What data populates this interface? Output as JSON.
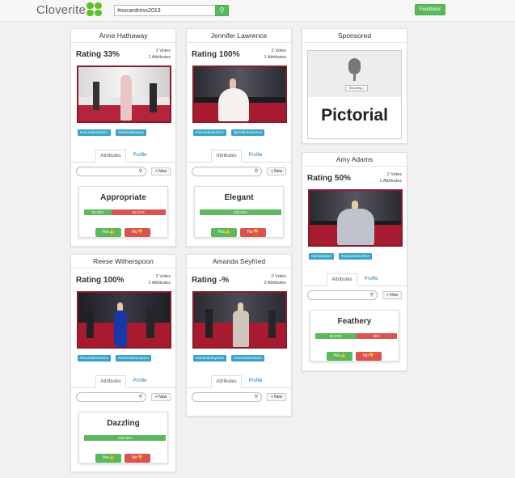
{
  "header": {
    "logo_text": "Cloverite",
    "search_value": "#oscardress2013",
    "search_icon": "search-icon",
    "feedback_label": "Feedback"
  },
  "colors": {
    "accent_green": "#5cb85c",
    "accent_red": "#d9534f",
    "tag_blue": "#3aa3c9",
    "link_blue": "#2a7ab8",
    "photo_border": "#8a1b2e"
  },
  "tab_labels": {
    "attributes": "Attributes",
    "profile": "Profile"
  },
  "new_label": "+ New",
  "yes_label": "Yes👍",
  "no_label": "No👎",
  "cards": [
    {
      "name": "Anne Hathaway",
      "rating": "Rating 33%",
      "votes": "3 Votes",
      "attributes": "1 Attributes",
      "tags": [
        "#oscardress2013",
        "#annehathaway"
      ],
      "attribute": {
        "name": "Appropriate",
        "yes_pct": "33.33%",
        "no_pct": "66.67%",
        "yes_fraction": 0.3333
      }
    },
    {
      "name": "Jennifer Lawrence",
      "rating": "Rating 100%",
      "votes": "2 Votes",
      "attributes": "1 Attributes",
      "tags": [
        "#oscardress2013",
        "#jenniferlawrence"
      ],
      "attribute": {
        "name": "Elegant",
        "yes_pct": "100.00%",
        "no_pct": "",
        "yes_fraction": 1.0
      }
    },
    {
      "name": "Reese Witherspoon",
      "rating": "Rating 100%",
      "votes": "2 Votes",
      "attributes": "1 Attributes",
      "tags": [
        "#oscardress2013",
        "#reesewitherspoon"
      ],
      "attribute": {
        "name": "Dazzling",
        "yes_pct": "100.00%",
        "no_pct": "",
        "yes_fraction": 1.0
      }
    },
    {
      "name": "Amanda Seyfried",
      "rating": "Rating -%",
      "votes": "0 Votes",
      "attributes": "0 Attributes",
      "tags": [
        "#amandaseyfried",
        "#oscardress2013"
      ]
    },
    {
      "name": "Amy Adams",
      "rating": "Rating 50%",
      "votes": "2 Votes",
      "attributes": "1 Attributes",
      "tags": [
        "#amyadams",
        "#oscardress2013"
      ],
      "attribute": {
        "name": "Feathery",
        "yes_pct": "50.00%",
        "no_pct": "50%",
        "yes_fraction": 0.5
      }
    }
  ],
  "sponsored": {
    "title": "Sponsored",
    "recording_label": "Recording...",
    "ad_text": "Pictorial",
    "icon": "microphone-icon"
  }
}
